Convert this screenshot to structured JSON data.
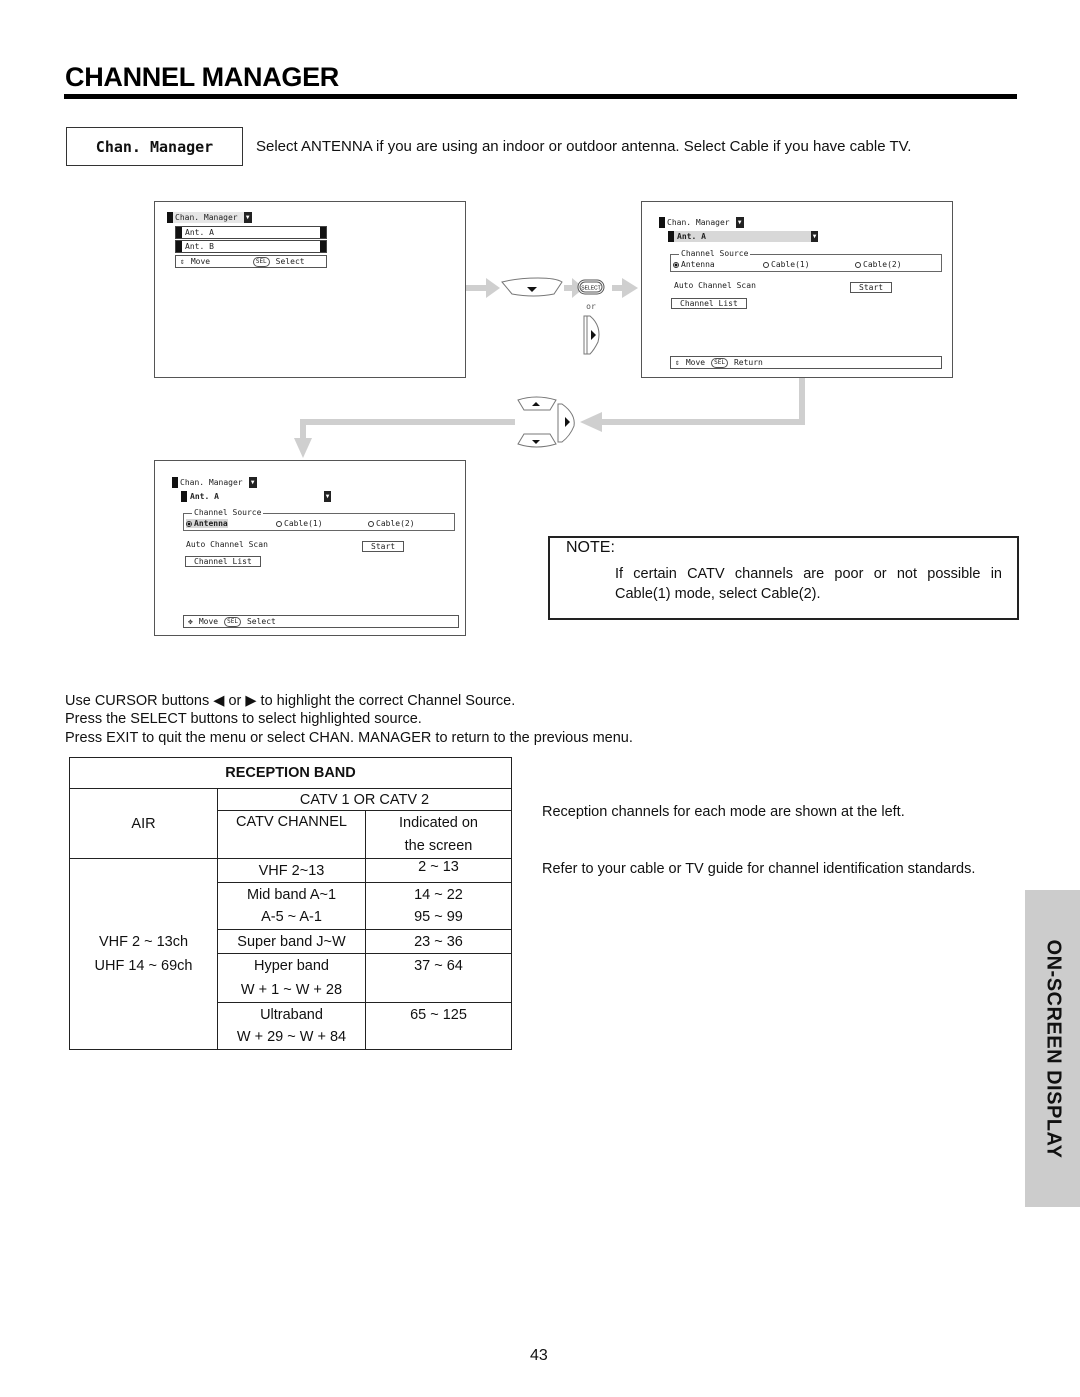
{
  "page": {
    "title": "CHANNEL MANAGER",
    "page_number": "43",
    "side_tab": "ON-SCREEN DISPLAY"
  },
  "intro": {
    "menu_label": "Chan. Manager",
    "text": "Select ANTENNA if you are using an indoor or outdoor antenna.  Select Cable if you have cable TV."
  },
  "screen1": {
    "menu_title": "Chan. Manager",
    "items": [
      "Ant. A",
      "Ant. B"
    ],
    "hint_move": "Move",
    "hint_sel": "SEL",
    "hint_action": "Select"
  },
  "screen2": {
    "menu_title": "Chan. Manager",
    "selected_ant": "Ant. A",
    "source_legend": "Channel Source",
    "sources": [
      "Antenna",
      "Cable(1)",
      "Cable(2)"
    ],
    "selected_source": "Antenna",
    "auto_scan_label": "Auto Channel Scan",
    "start_button": "Start",
    "channel_list_button": "Channel List",
    "hint_move": "Move",
    "hint_sel": "SEL",
    "hint_action": "Return"
  },
  "screen3": {
    "menu_title": "Chan. Manager",
    "selected_ant": "Ant. A",
    "source_legend": "Channel Source",
    "sources": [
      "Antenna",
      "Cable(1)",
      "Cable(2)"
    ],
    "selected_source": "Antenna",
    "auto_scan_label": "Auto Channel Scan",
    "start_button": "Start",
    "channel_list_button": "Channel List",
    "hint_move": "Move",
    "hint_sel": "SEL",
    "hint_action": "Select"
  },
  "flow": {
    "select_button_label": "SELECT",
    "or_label": "or"
  },
  "note": {
    "title": "NOTE:",
    "text": "If certain CATV channels are poor or not possible in Cable(1) mode, select Cable(2)."
  },
  "instructions": [
    "Use CURSOR buttons ◀ or ▶ to highlight the correct Channel Source.",
    "Press the SELECT buttons to select highlighted source.",
    "Press EXIT to quit the menu or select CHAN. MANAGER to return to the previous menu."
  ],
  "reception_table": {
    "title": "RECEPTION BAND",
    "air_header": "AIR",
    "catv_header": "CATV 1 OR CATV 2",
    "catv_channel_header": "CATV CHANNEL",
    "indicated_header_1": "Indicated on",
    "indicated_header_2": "the screen",
    "air_value_1": "VHF 2 ~ 13ch",
    "air_value_2": "UHF 14 ~ 69ch",
    "rows": [
      {
        "band": [
          "VHF 2~13"
        ],
        "screen": [
          "2 ~ 13"
        ]
      },
      {
        "band": [
          "Mid band A~1",
          "A-5 ~ A-1"
        ],
        "screen": [
          "14 ~ 22",
          "95 ~ 99"
        ]
      },
      {
        "band": [
          "Super band J~W"
        ],
        "screen": [
          "23 ~ 36"
        ]
      },
      {
        "band": [
          "Hyper band",
          "W + 1 ~ W + 28"
        ],
        "screen": [
          "37 ~ 64"
        ]
      },
      {
        "band": [
          "Ultraband",
          "W + 29 ~ W + 84"
        ],
        "screen": [
          "65 ~ 125"
        ]
      }
    ]
  },
  "side_notes": [
    "Reception channels for each mode are shown at the left.",
    "Refer to your cable or TV guide for channel identification standards."
  ]
}
